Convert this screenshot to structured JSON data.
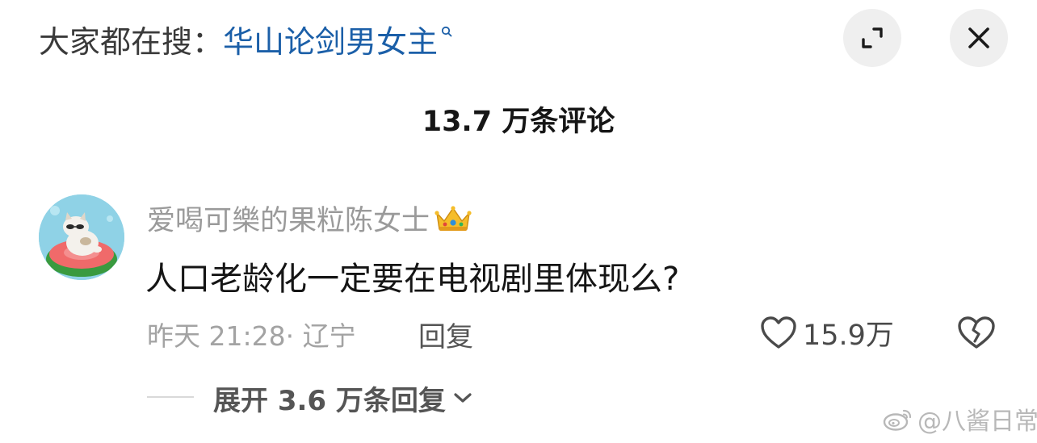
{
  "search": {
    "prefix": "大家都在搜：",
    "term": "华山论剑男女主",
    "icon": "search-icon"
  },
  "header": {
    "expand_icon": "expand-icon",
    "close_icon": "close-icon"
  },
  "comments_header": {
    "count": "13.7 万条评论"
  },
  "comment": {
    "username": "爱喝可樂的果粒陈女士",
    "badge_icon": "crown-icon",
    "text": "人口老龄化一定要在电视剧里体现么?",
    "time_location": "昨天 21:28· 辽宁",
    "reply_label": "回复",
    "likes": "15.9万",
    "like_icon": "heart-outline-icon",
    "dislike_icon": "broken-heart-icon",
    "expand_replies": "展开 3.6 万条回复",
    "expand_icon": "chevron-down-icon"
  },
  "watermark": {
    "text": "@八酱日常",
    "logo_icon": "weibo-logo-icon"
  },
  "colors": {
    "search_term": "#1b5fa8",
    "muted_text": "#9a9a9a",
    "button_bg": "#efefef"
  }
}
